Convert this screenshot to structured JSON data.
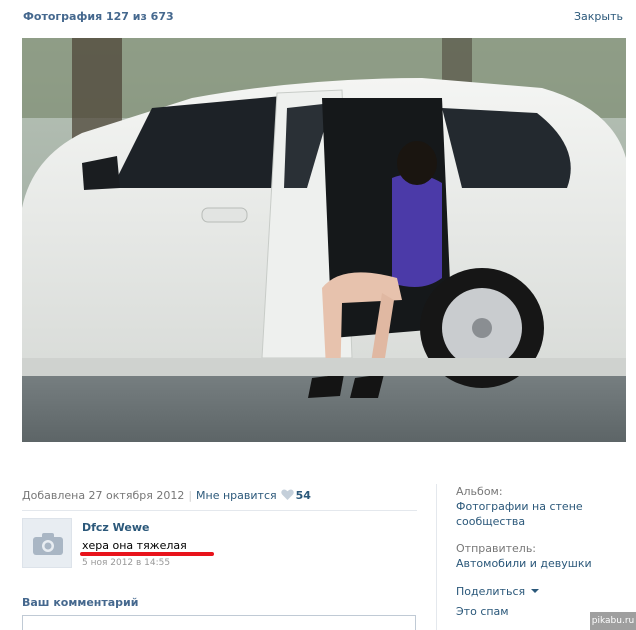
{
  "header": {
    "title": "Фотография 127 из 673",
    "close_label": "Закрыть"
  },
  "photo": {
    "description_icon": "photo-car-scene"
  },
  "meta": {
    "added": "Добавлена 27 октября 2012",
    "like_label": "Мне нравится",
    "like_count": "54"
  },
  "comment": {
    "author": "Dfcz Wewe",
    "text": "хера она тяжелая",
    "date": "5 ноя 2012 в 14:55",
    "avatar_icon": "camera-icon"
  },
  "your_comment": {
    "label": "Ваш комментарий"
  },
  "sidebar": {
    "album_label": "Альбом:",
    "album_value": "Фотографии на стене сообщества",
    "sender_label": "Отправитель:",
    "sender_value": "Автомобили и девушки",
    "share_label": "Поделиться",
    "spam_label": "Это спам"
  },
  "watermark": "pikabu.ru",
  "colors": {
    "link": "#2b587a",
    "title": "#45688e",
    "underline": "#e8131b"
  }
}
